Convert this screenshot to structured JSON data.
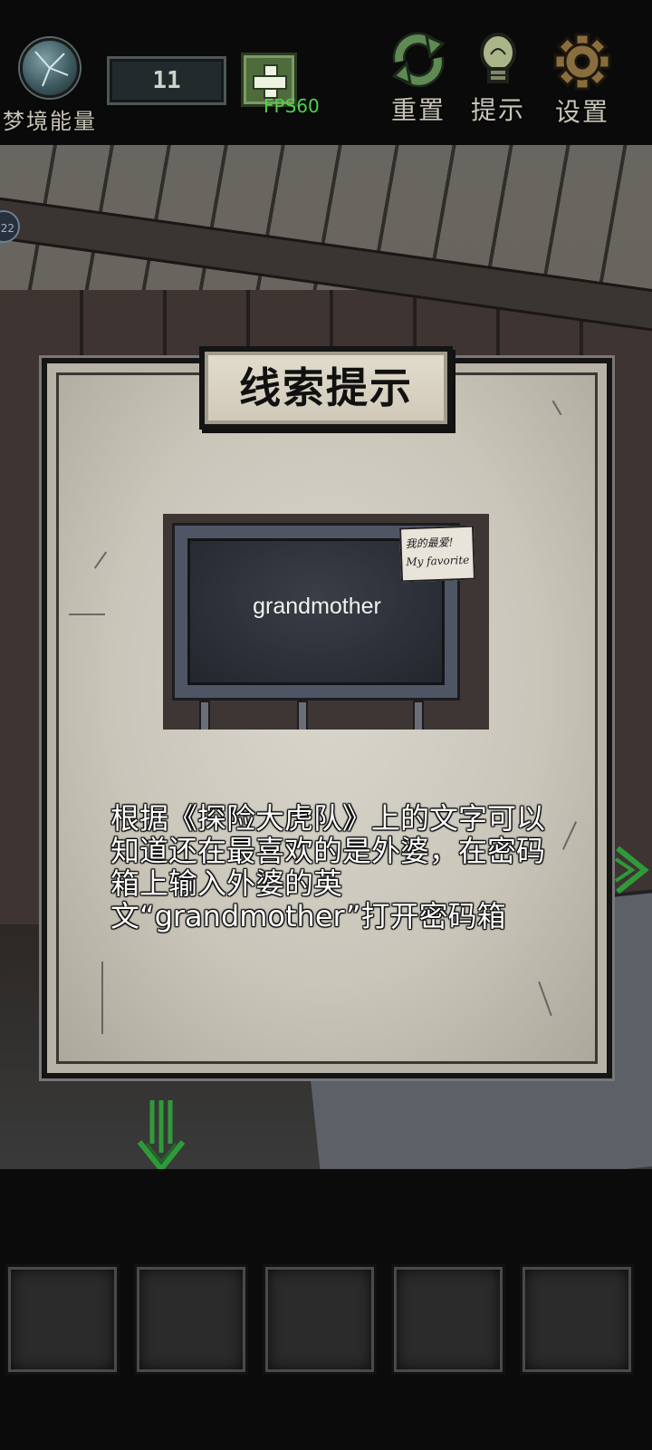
{
  "topbar": {
    "energy_label": "梦境能量",
    "energy_count": "11",
    "fps_label": "FPS60",
    "reset_label": "重置",
    "hint_label": "提示",
    "settings_label": "设置"
  },
  "side_badge": "22",
  "dialog": {
    "title": "线索提示",
    "image_word": "grandmother",
    "note_text": "我的最爱! My favorite",
    "clue_text": "根据《探险大虎队》上的文字可以知道还在最喜欢的是外婆，在密码箱上输入外婆的英文“grandmother”打开密码箱"
  },
  "inventory": {
    "slots": [
      "",
      "",
      "",
      "",
      ""
    ]
  },
  "colors": {
    "fps": "#4fd24a",
    "nav_arrow": "#2f9a3a",
    "paper": "#d9d6cc",
    "board": "#23262d"
  },
  "icons": [
    "cracked-orb-icon",
    "plus-icon",
    "reset-icon",
    "lightbulb-icon",
    "gear-icon",
    "down-arrow-icon",
    "right-arrow-icon"
  ]
}
